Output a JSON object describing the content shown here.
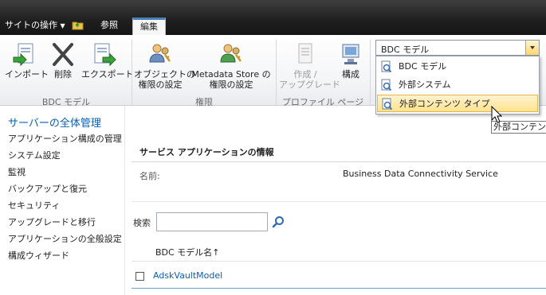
{
  "top_tabs": {
    "site_actions": "サイトの操作",
    "browse": "参照",
    "edit": "編集"
  },
  "ribbon": {
    "groups": {
      "bdc_model": "BDC モデル",
      "permissions": "権限",
      "profile_page": "プロファイル ページ"
    },
    "buttons": {
      "import": "インポート",
      "delete": "削除",
      "export": "エクスポート",
      "object_perm_line1": "オブジェクトの",
      "object_perm_line2": "権限の設定",
      "metadata_perm_line1": "Metadata Store の",
      "metadata_perm_line2": "権限の設定",
      "create_upgrade_line1": "作成 /",
      "create_upgrade_line2": "アップグレード",
      "configure": "構成"
    }
  },
  "view_dropdown": {
    "selected": "BDC モデル",
    "options": [
      "BDC モデル",
      "外部システム",
      "外部コンテンツ タイプ"
    ],
    "highlighted_index": 2
  },
  "tooltip": "外部コンテンツ",
  "left_nav": {
    "title": "サーバーの全体管理",
    "items": [
      "アプリケーション構成の管理",
      "システム設定",
      "監視",
      "バックアップと復元",
      "セキュリティ",
      "アップグレードと移行",
      "アプリケーションの全般設定",
      "構成ウィザード"
    ]
  },
  "main": {
    "section_title": "サービス アプリケーションの情報",
    "name_label": "名前:",
    "name_value": "Business Data Connectivity Service",
    "search_label": "検索",
    "search_value": "",
    "column_header": "BDC モデル名↑",
    "rows": [
      "AdskVaultModel"
    ]
  },
  "colors": {
    "accent": "#0a5fb5",
    "highlight": "#ffe38f",
    "topbar": "#1e1e1e"
  }
}
